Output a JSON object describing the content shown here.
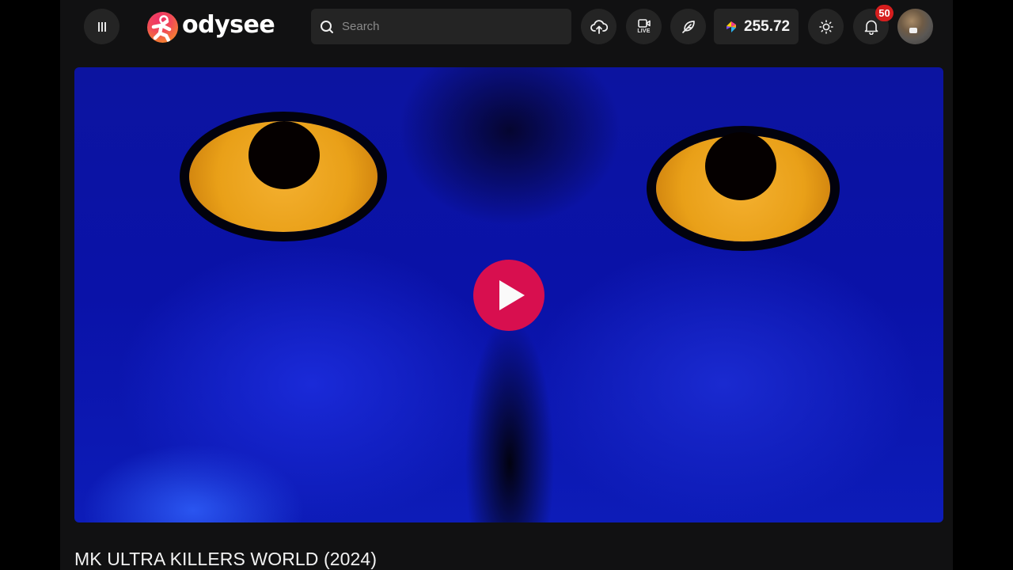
{
  "header": {
    "menu_icon": "menu-icon",
    "logo_text": "odysee",
    "search": {
      "placeholder": "Search",
      "value": "",
      "icon": "search-icon"
    },
    "upload_icon": "cloud-upload-icon",
    "live": {
      "icon": "video-camera-icon",
      "label": "LIVE"
    },
    "publish_icon": "feather-icon",
    "credits": {
      "icon": "lbc-credits-icon",
      "amount": "255.72"
    },
    "theme_icon": "sun-icon",
    "notifications": {
      "icon": "bell-icon",
      "count": "50"
    },
    "avatar": "user-avatar"
  },
  "video": {
    "thumbnail": "owl-eyes-thumbnail",
    "play_icon": "play-icon",
    "title": "MK ULTRA KILLERS WORLD (2024)"
  },
  "colors": {
    "brand": "#d80f4f",
    "badge": "#d61e1e",
    "surface": "#242424",
    "background": "#111112"
  }
}
